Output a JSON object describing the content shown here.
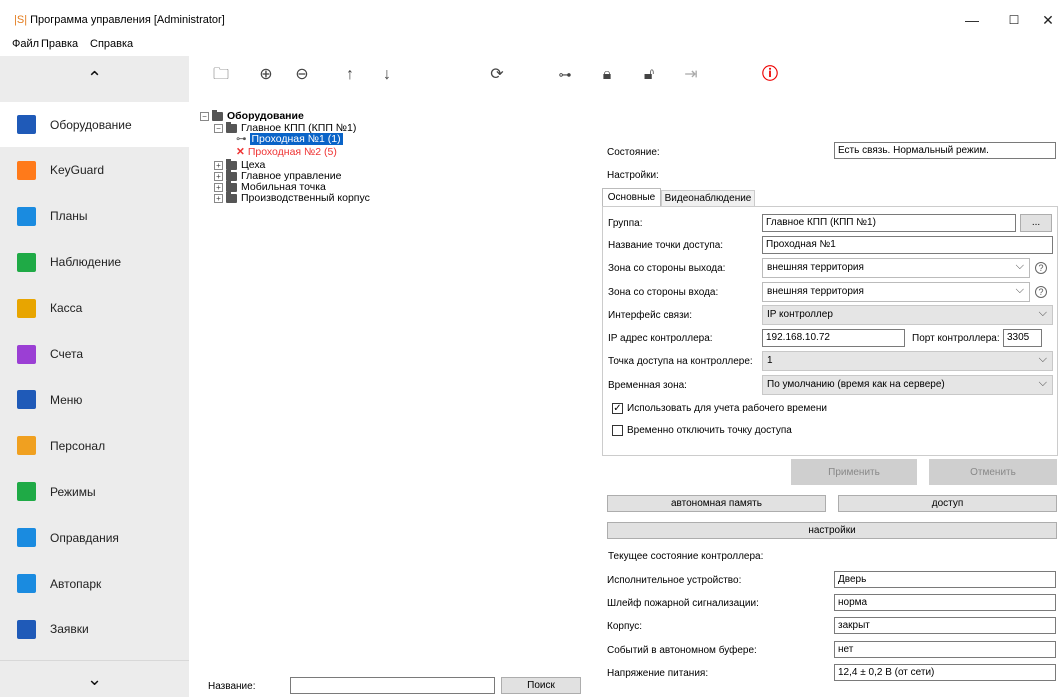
{
  "window": {
    "logo": "|S|",
    "title": "Программа управления [Administrator]",
    "min": "—",
    "max": "☐",
    "close": "✕"
  },
  "menu": [
    "Файл",
    "Правка",
    "Справка"
  ],
  "sidebar": {
    "items": [
      {
        "label": "Оборудование",
        "icon": "network-icon",
        "color": "#1f5ab8"
      },
      {
        "label": "KeyGuard",
        "icon": "keyguard-icon",
        "color": "#ff7a1a"
      },
      {
        "label": "Планы",
        "icon": "plans-icon",
        "color": "#1a8be0"
      },
      {
        "label": "Наблюдение",
        "icon": "monitor-icon",
        "color": "#1faa46"
      },
      {
        "label": "Касса",
        "icon": "cash-icon",
        "color": "#e8a500"
      },
      {
        "label": "Счета",
        "icon": "accounts-icon",
        "color": "#9b3fd4"
      },
      {
        "label": "Меню",
        "icon": "menu-icon",
        "color": "#1f5ab8"
      },
      {
        "label": "Персонал",
        "icon": "staff-icon",
        "color": "#f0a020"
      },
      {
        "label": "Режимы",
        "icon": "modes-icon",
        "color": "#1faa46"
      },
      {
        "label": "Оправдания",
        "icon": "excuses-icon",
        "color": "#1a8be0"
      },
      {
        "label": "Автопарк",
        "icon": "car-icon",
        "color": "#1a8be0"
      },
      {
        "label": "Заявки",
        "icon": "requests-icon",
        "color": "#1f5ab8"
      }
    ]
  },
  "tree": {
    "root": "Оборудование",
    "n1": "Главное КПП (КПП №1)",
    "n1a": "Проходная №1 (1)",
    "n1b": "Проходная №2 (5)",
    "n2": "Цеха",
    "n3": "Главное управление",
    "n4": "Мобильная точка",
    "n5": "Производственный корпус"
  },
  "search": {
    "label": "Название:",
    "value": "",
    "button": "Поиск"
  },
  "state": {
    "label": "Состояние:",
    "value": "Есть связь. Нормальный режим."
  },
  "settings_label": "Настройки:",
  "tabs": [
    "Основные",
    "Видеонаблюдение"
  ],
  "form": {
    "group_label": "Группа:",
    "group_value": "Главное КПП (КПП №1)",
    "group_btn": "...",
    "name_label": "Название точки доступа:",
    "name_value": "Проходная №1",
    "exit_label": "Зона со стороны выхода:",
    "exit_value": "внешняя территория",
    "entry_label": "Зона со стороны входа:",
    "entry_value": "внешняя территория",
    "iface_label": "Интерфейс связи:",
    "iface_value": "IP контроллер",
    "ip_label": "IP адрес контроллера:",
    "ip_value": "192.168.10.72",
    "port_label": "Порт контроллера:",
    "port_value": "3305",
    "point_label": "Точка доступа на контроллере:",
    "point_value": "1",
    "tz_label": "Временная зона:",
    "tz_value": "По умолчанию (время как на сервере)",
    "cb1": "Использовать для учета рабочего времени",
    "cb1_checked": true,
    "cb2": "Временно отключить точку доступа",
    "cb2_checked": false
  },
  "apply": "Применить",
  "cancel": "Отменить",
  "btn_memory": "автономная память",
  "btn_access": "доступ",
  "btn_settings": "настройки",
  "controller": {
    "title": "Текущее состояние контроллера:",
    "rows": [
      {
        "label": "Исполнительное устройство:",
        "value": "Дверь"
      },
      {
        "label": "Шлейф пожарной сигнализации:",
        "value": "норма"
      },
      {
        "label": "Корпус:",
        "value": "закрыт"
      },
      {
        "label": "Событий в автономном буфере:",
        "value": "нет"
      },
      {
        "label": "Напряжение питания:",
        "value": "12,4 ± 0,2 В (от сети)"
      }
    ]
  }
}
